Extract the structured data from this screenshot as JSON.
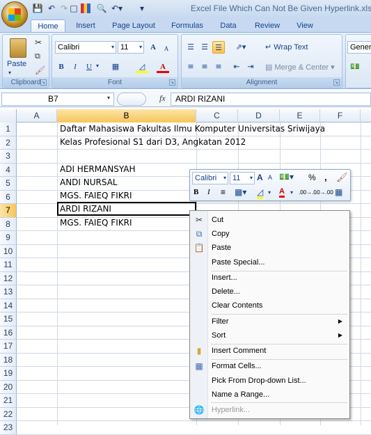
{
  "window": {
    "title": "Excel File Which Can Not Be Given Hyperlink.xls"
  },
  "quick_access": {
    "icons": [
      "save-icon",
      "undo-icon",
      "redo-icon",
      "new-icon",
      "chart-icon",
      "print-preview-icon",
      "undo-icon",
      "customize-icon"
    ]
  },
  "tabs": [
    {
      "label": "Home",
      "active": true
    },
    {
      "label": "Insert"
    },
    {
      "label": "Page Layout"
    },
    {
      "label": "Formulas"
    },
    {
      "label": "Data"
    },
    {
      "label": "Review"
    },
    {
      "label": "View"
    }
  ],
  "ribbon": {
    "clipboard": {
      "label": "Clipboard",
      "paste_label": "Paste"
    },
    "font": {
      "label": "Font",
      "font_name": "Calibri",
      "font_size": "11",
      "bold": "B",
      "italic": "I",
      "underline": "U",
      "grow": "A",
      "shrink": "A"
    },
    "alignment": {
      "label": "Alignment",
      "wrap_text": "Wrap Text",
      "merge_center": "Merge & Center"
    },
    "number": {
      "format": "Genera"
    }
  },
  "formula_bar": {
    "name_box": "B7",
    "fx": "fx",
    "content": "ARDI RIZANI"
  },
  "grid": {
    "columns": [
      "A",
      "B",
      "C",
      "D",
      "E",
      "F"
    ],
    "selected_column": "B",
    "rows": [
      "1",
      "2",
      "3",
      "4",
      "5",
      "6",
      "7",
      "8",
      "9",
      "10",
      "11",
      "12",
      "13",
      "14",
      "15",
      "16",
      "17",
      "18",
      "19",
      "20",
      "21",
      "22",
      "23"
    ],
    "selected_row": "7",
    "cells": {
      "b1": "Daftar Mahasiswa Fakultas Ilmu Komputer Universitas Sriwijaya",
      "b2": "Kelas Profesional S1 dari D3, Angkatan 2012",
      "b4": "ADI HERMANSYAH",
      "b5": "ANDI NURSAL",
      "b6": "MGS. FAIEQ FIKRI",
      "b7": "ARDI RIZANI",
      "b8": "MGS. FAIEQ FIKRI"
    }
  },
  "mini_toolbar": {
    "font_name": "Calibri",
    "font_size": "11",
    "grow": "A",
    "shrink": "A",
    "percent": "%",
    "comma": ",",
    "bold": "B",
    "italic": "I",
    "font_color": "A",
    "inc_decimal": ".00→.0",
    "dec_decimal": ".0→.00"
  },
  "context_menu": {
    "items": [
      {
        "label": "Cut",
        "icon": "scissors-icon"
      },
      {
        "label": "Copy",
        "icon": "copy-icon"
      },
      {
        "label": "Paste",
        "icon": "paste-icon"
      },
      {
        "label": "Paste Special..."
      },
      {
        "label": "Insert..."
      },
      {
        "label": "Delete..."
      },
      {
        "label": "Clear Contents"
      },
      {
        "label": "Filter",
        "submenu": true
      },
      {
        "label": "Sort",
        "submenu": true
      },
      {
        "label": "Insert Comment",
        "icon": "comment-icon"
      },
      {
        "label": "Format Cells...",
        "icon": "format-cells-icon"
      },
      {
        "label": "Pick From Drop-down List..."
      },
      {
        "label": "Name a Range..."
      },
      {
        "label": "Hyperlink...",
        "icon": "hyperlink-icon",
        "disabled": true
      }
    ]
  }
}
